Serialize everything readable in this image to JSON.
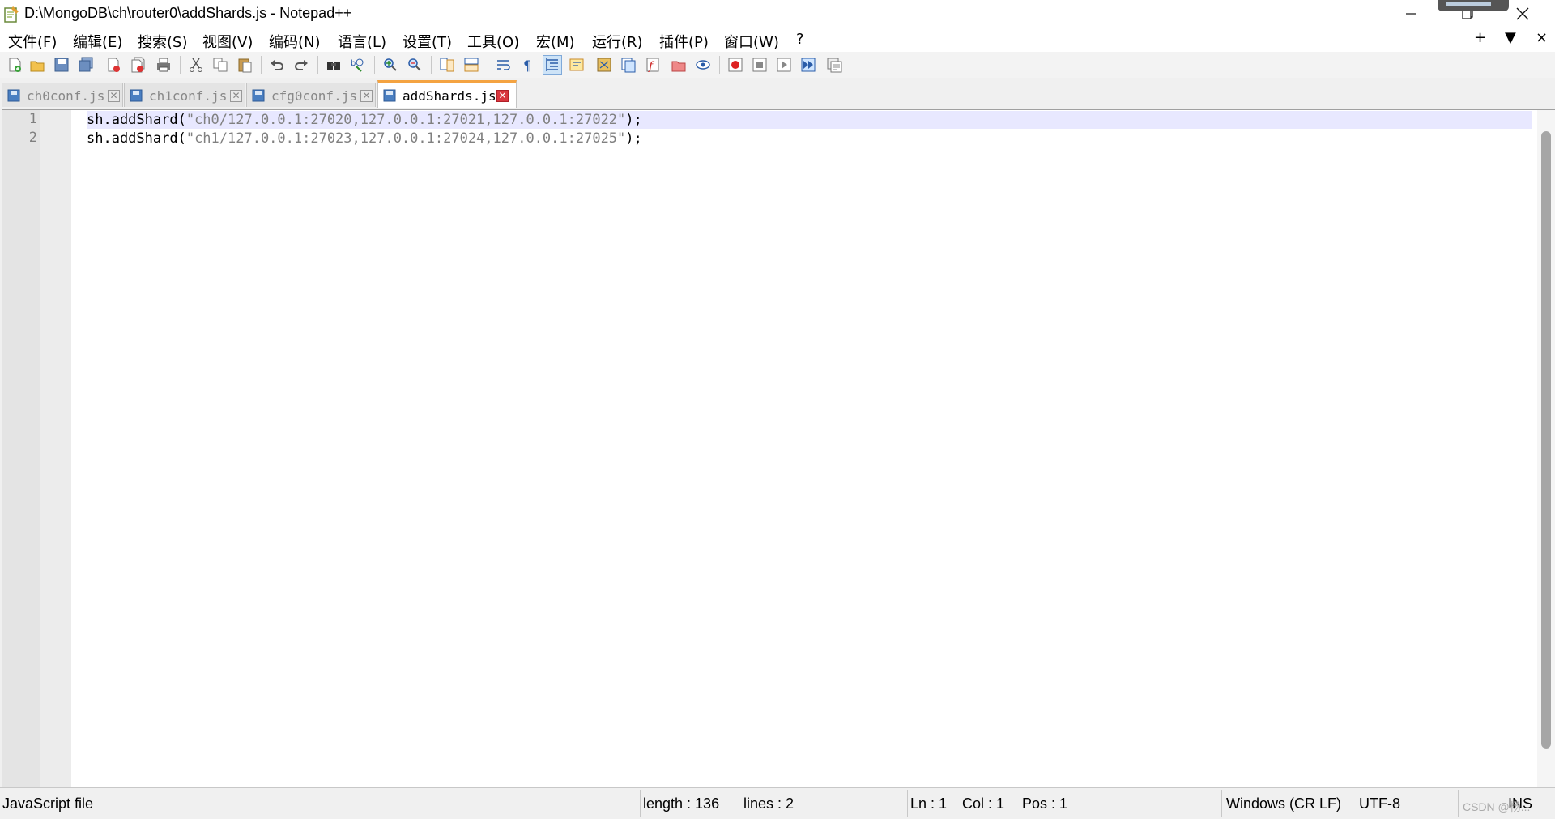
{
  "window": {
    "title": "D:\\MongoDB\\ch\\router0\\addShards.js - Notepad++",
    "minimize_icon": "minimize-icon",
    "maximize_icon": "restore-icon",
    "close_icon": "close-icon"
  },
  "menu": {
    "items": [
      "文件(F)",
      "编辑(E)",
      "搜索(S)",
      "视图(V)",
      "编码(N)",
      "语言(L)",
      "设置(T)",
      "工具(O)",
      "宏(M)",
      "运行(R)",
      "插件(P)",
      "窗口(W)",
      "?"
    ],
    "right": [
      "+",
      "▼",
      "×"
    ]
  },
  "toolbar": {
    "buttons": [
      "new-file-icon",
      "open-file-icon",
      "save-icon",
      "save-all-icon",
      "close-icon",
      "close-all-icon",
      "print-icon",
      "cut-icon",
      "copy-icon",
      "paste-icon",
      "undo-icon",
      "redo-icon",
      "find-icon",
      "replace-icon",
      "zoom-in-icon",
      "zoom-out-icon",
      "sync-vertical-icon",
      "sync-horizontal-icon",
      "word-wrap-icon",
      "show-all-chars-icon",
      "indent-guide-icon",
      "user-defined-lang-icon",
      "doc-map-icon",
      "function-list-icon",
      "folder-workspace-icon",
      "monitor-icon",
      "record-macro-icon",
      "stop-macro-icon",
      "play-macro-icon",
      "run-macro-multiple-icon",
      "save-macro-icon"
    ]
  },
  "tabs": [
    {
      "label": "ch0conf.js",
      "active": false
    },
    {
      "label": "ch1conf.js",
      "active": false
    },
    {
      "label": "cfg0conf.js",
      "active": false
    },
    {
      "label": "addShards.js",
      "active": true
    }
  ],
  "editor": {
    "lines": [
      {
        "number": "1",
        "prefix": "sh.addShard(",
        "string": "\"ch0/127.0.0.1:27020,127.0.0.1:27021,127.0.0.1:27022\"",
        "suffix": ");",
        "current": true
      },
      {
        "number": "2",
        "prefix": "sh.addShard(",
        "string": "\"ch1/127.0.0.1:27023,127.0.0.1:27024,127.0.0.1:27025\"",
        "suffix": ");",
        "current": false
      }
    ],
    "current_line_color": "#e8e8ff",
    "string_color": "#808080"
  },
  "status": {
    "file_type": "JavaScript file",
    "length": "length : 136",
    "lines": "lines : 2",
    "ln": "Ln : 1",
    "col": "Col : 1",
    "pos": "Pos : 1",
    "eol": "Windows (CR LF)",
    "encoding": "UTF-8",
    "mode": "INS",
    "watermark": "CSDN @杨..."
  }
}
